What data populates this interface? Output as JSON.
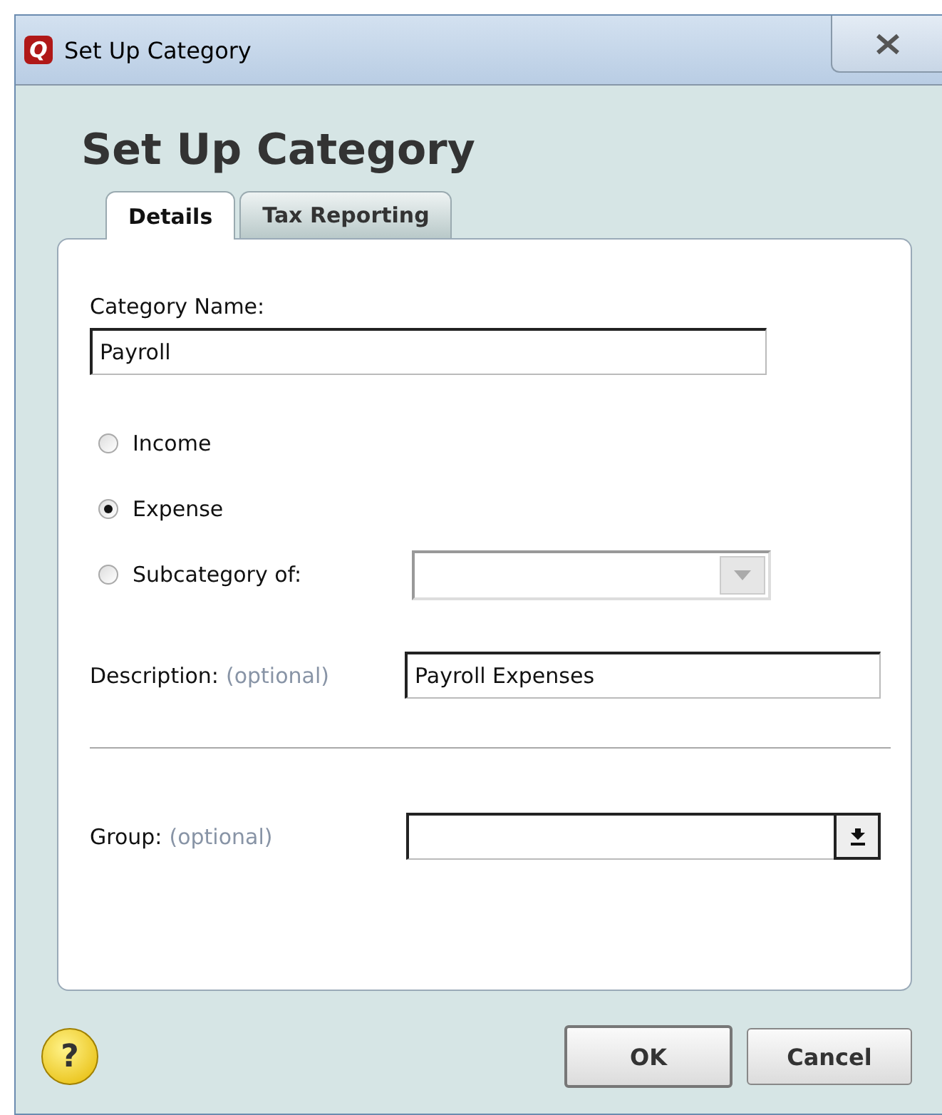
{
  "window": {
    "app_icon": "Q",
    "title": "Set Up Category"
  },
  "heading": "Set Up Category",
  "tabs": [
    {
      "label": "Details",
      "selected": true
    },
    {
      "label": "Tax Reporting",
      "selected": false
    }
  ],
  "category_name": {
    "label": "Category Name:",
    "value": "Payroll"
  },
  "types": [
    {
      "label": "Income",
      "selected": false
    },
    {
      "label": "Expense",
      "selected": true
    },
    {
      "label": "Subcategory of:",
      "selected": false
    }
  ],
  "subcategory_combo": {
    "disabled": true
  },
  "description": {
    "label": "Description:",
    "hint": "(optional)",
    "value": "Payroll Expenses"
  },
  "group": {
    "label": "Group:",
    "hint": "(optional)"
  },
  "help": {
    "label": "?"
  },
  "buttons": [
    "OK",
    "Cancel"
  ]
}
